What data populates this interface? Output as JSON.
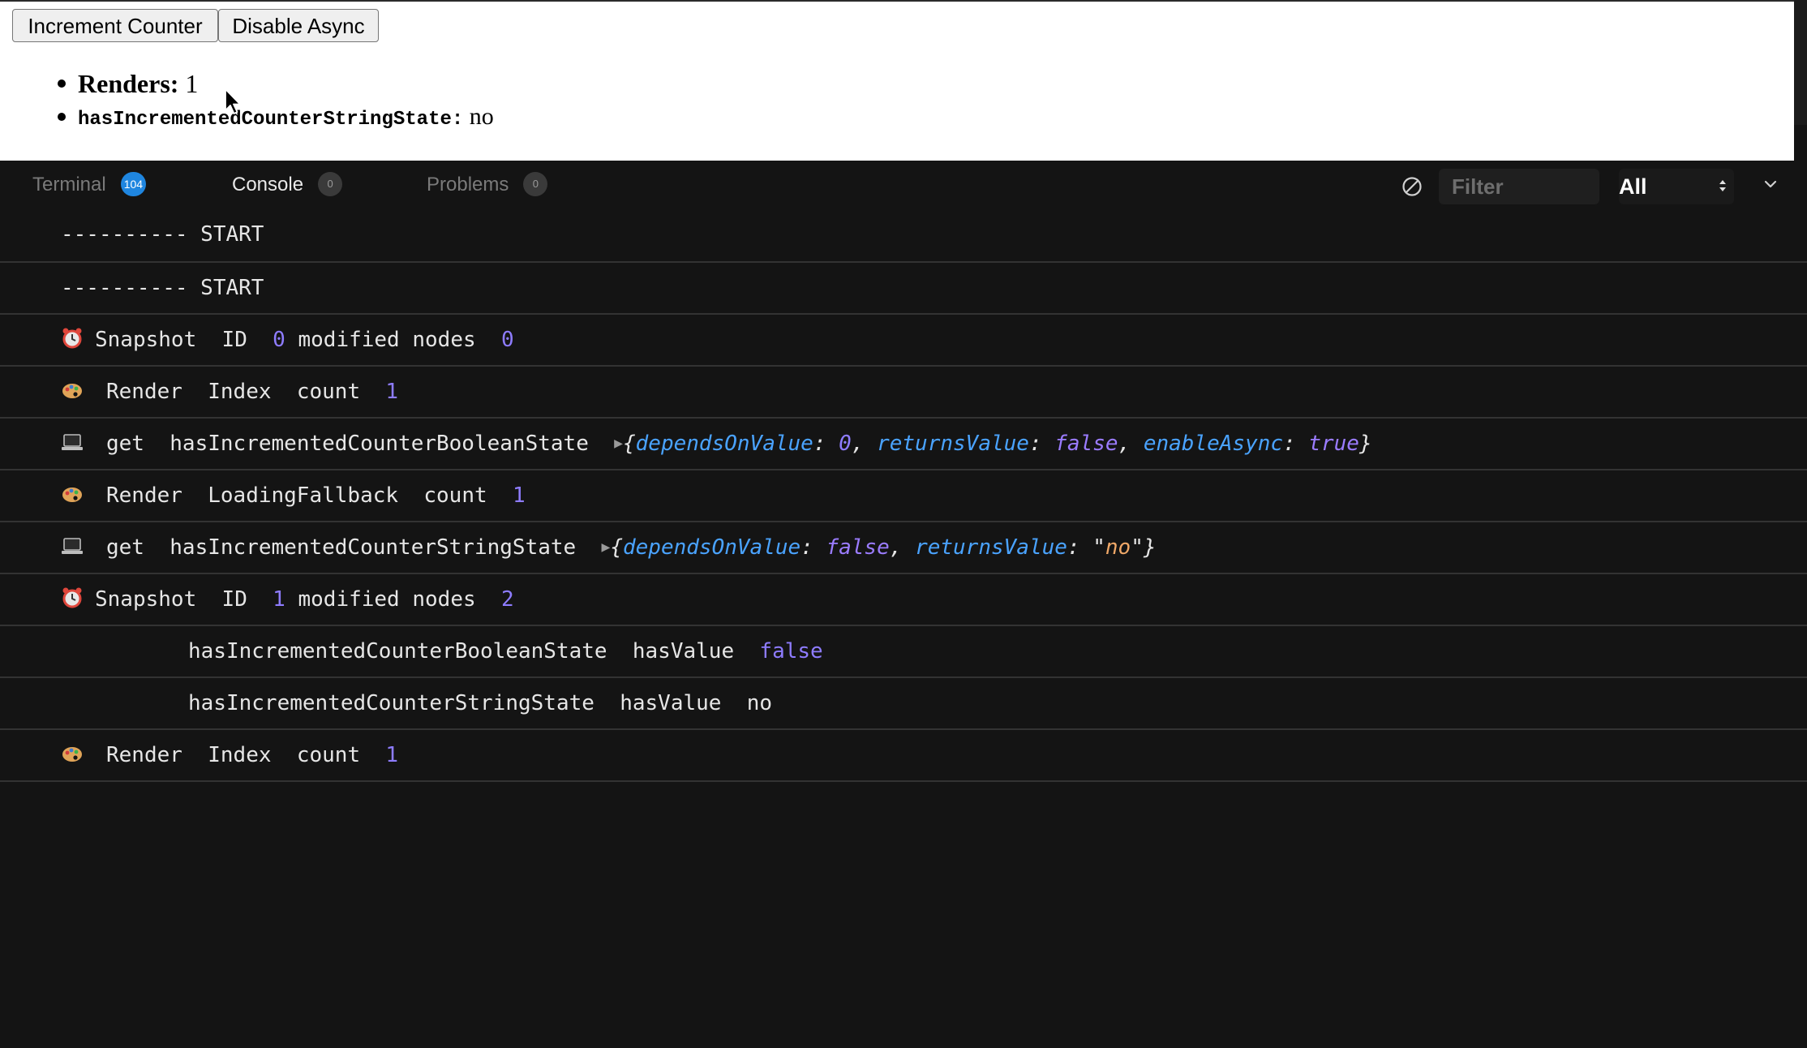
{
  "preview": {
    "buttons": {
      "increment": "Increment Counter",
      "disable_async": "Disable Async"
    },
    "stats": [
      {
        "label": "Renders:",
        "value": "1"
      },
      {
        "label": "hasIncrementedCounterStringState:",
        "value": "no"
      }
    ]
  },
  "tabs": [
    {
      "label": "Terminal",
      "badge": "104"
    },
    {
      "label": "Console",
      "badge": "0"
    },
    {
      "label": "Problems",
      "badge": "0"
    }
  ],
  "toolbar": {
    "filter_placeholder": "Filter",
    "level_select": "All"
  },
  "icons": {
    "clear": "block-icon",
    "alarm": "alarm-clock-icon",
    "palette": "palette-icon",
    "laptop": "laptop-icon",
    "expand": "expand-triangle-icon",
    "collapse": "chevron-down-icon",
    "cursor": "mouse-pointer-icon"
  },
  "colors": {
    "number": "#8e7cff",
    "object_key": "#4aa3ff",
    "string_value": "#f0a868",
    "badge_blue": "#1f86e0"
  },
  "log": [
    {
      "text": "---------- START"
    },
    {
      "text": "---------- START"
    },
    {
      "label": "Snapshot",
      "k1": "ID",
      "v1": "0",
      "k2": "modified nodes",
      "v2": "0"
    },
    {
      "label": "Render",
      "component": "Index",
      "k": "count",
      "v": "1"
    },
    {
      "label": "get",
      "atom": "hasIncrementedCounterBooleanState",
      "obj": [
        {
          "key": "dependsOnValue",
          "value": "0"
        },
        {
          "key": "returnsValue",
          "value": "false"
        },
        {
          "key": "enableAsync",
          "value": "true"
        }
      ]
    },
    {
      "label": "Render",
      "component": "LoadingFallback",
      "k": "count",
      "v": "1"
    },
    {
      "label": "get",
      "atom": "hasIncrementedCounterStringState",
      "obj": [
        {
          "key": "dependsOnValue",
          "value": "false"
        },
        {
          "key": "returnsValue",
          "value": "no"
        }
      ]
    },
    {
      "label": "Snapshot",
      "k1": "ID",
      "v1": "1",
      "k2": "modified nodes",
      "v2": "2"
    },
    {
      "atom": "hasIncrementedCounterBooleanState",
      "k": "hasValue",
      "v": "false"
    },
    {
      "atom": "hasIncrementedCounterStringState",
      "k": "hasValue",
      "v": "no"
    },
    {
      "label": "Render",
      "component": "Index",
      "k": "count",
      "v": "1"
    }
  ]
}
